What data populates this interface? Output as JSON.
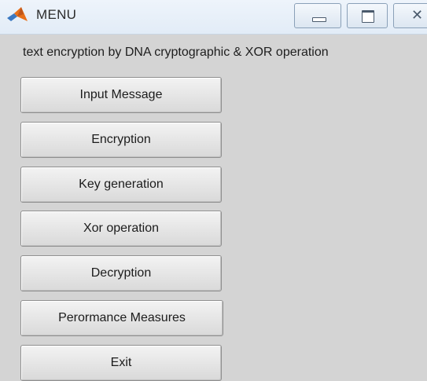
{
  "window": {
    "title": "MENU",
    "controls": [
      "minimize",
      "maximize",
      "close"
    ]
  },
  "header": {
    "label": "text encryption by DNA cryptographic & XOR operation"
  },
  "menu": {
    "buttons": [
      {
        "label": "Input Message"
      },
      {
        "label": "Encryption"
      },
      {
        "label": "Key generation"
      },
      {
        "label": "Xor operation"
      },
      {
        "label": "Decryption"
      },
      {
        "label": "Perormance Measures"
      },
      {
        "label": "Exit"
      }
    ]
  },
  "icons": {
    "app": "matlab-logo-icon",
    "close_glyph": "✕"
  },
  "colors": {
    "window_background": "#d4d4d4",
    "titlebar": "#e2ecf7",
    "logo_orange": "#e8701a",
    "logo_blue": "#3a78c2"
  }
}
